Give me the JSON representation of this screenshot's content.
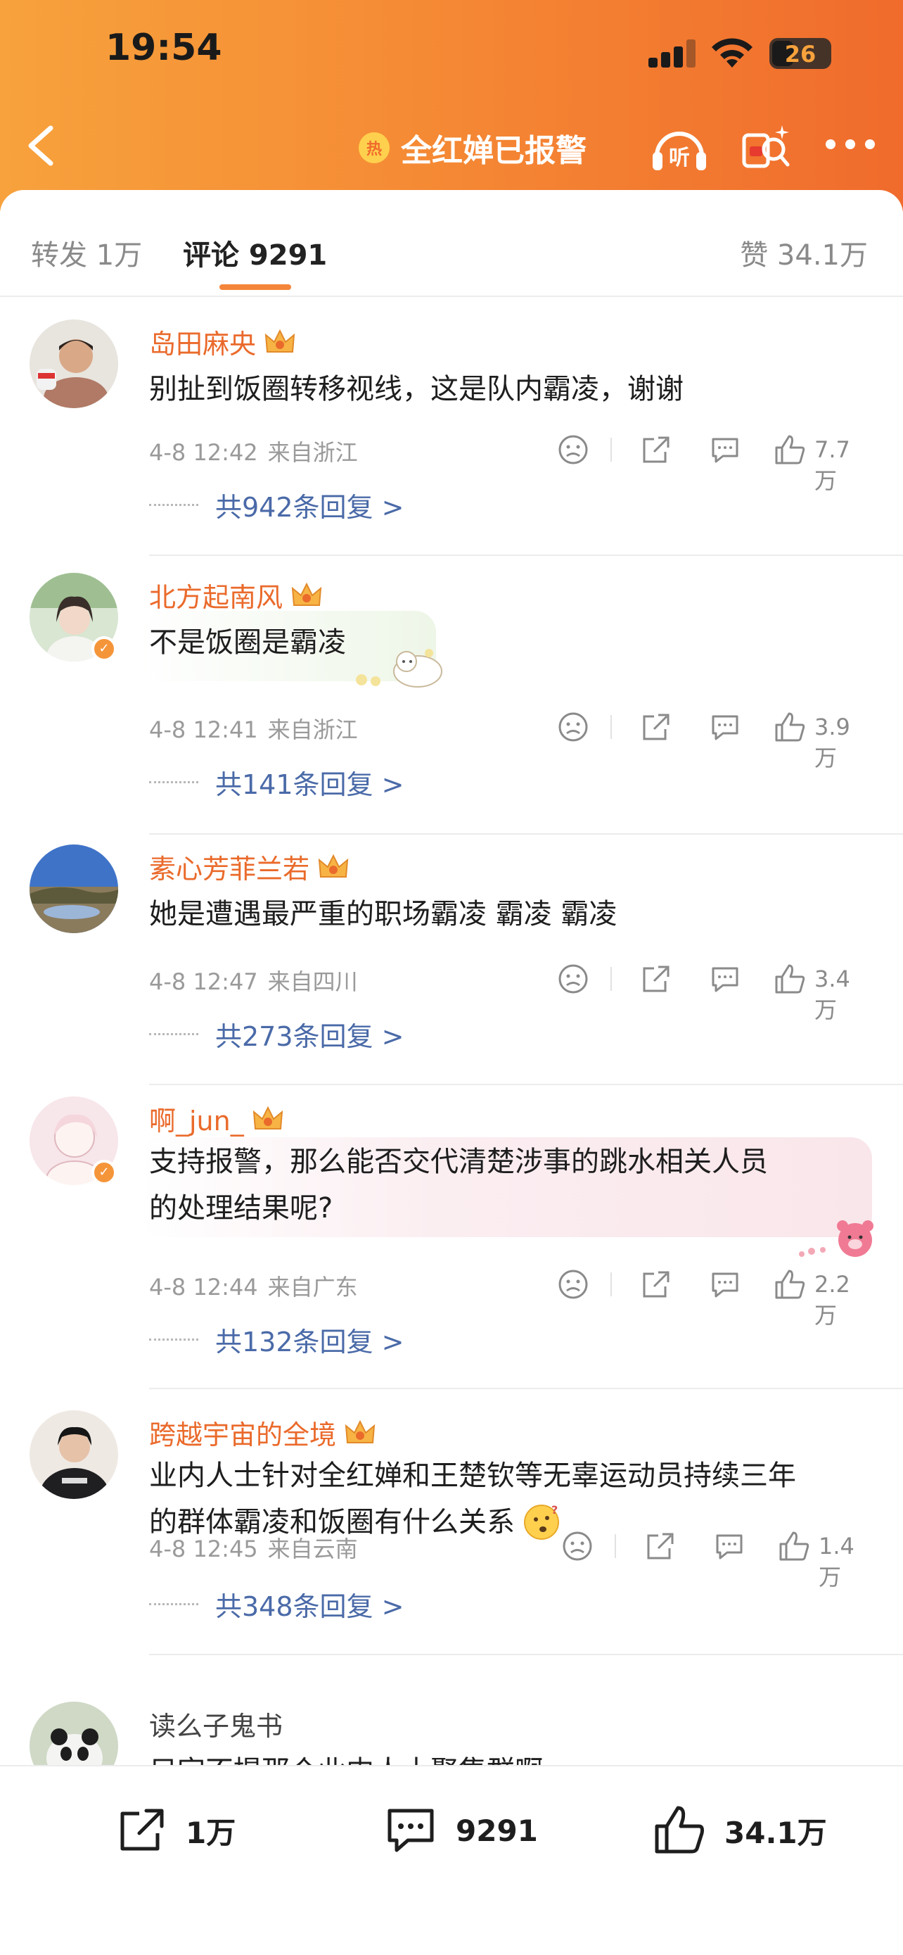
{
  "status_bar": {
    "time": "19:54",
    "battery": "26"
  },
  "nav": {
    "hot_badge": "热",
    "title": "全红婵已报警",
    "listen_label": "听"
  },
  "tabs": {
    "repost": "转发 1万",
    "comments": "评论 9291",
    "likes": "赞 34.1万"
  },
  "comments": [
    {
      "user": "岛田麻央",
      "text": "别扯到饭圈转移视线，这是队内霸凌，谢谢",
      "time": "4-8 12:42",
      "location": "来自浙江",
      "likes": "7.7万",
      "replies": "共942条回复 >"
    },
    {
      "user": "北方起南风",
      "text": "不是饭圈是霸凌",
      "time": "4-8 12:41",
      "location": "来自浙江",
      "likes": "3.9万",
      "replies": "共141条回复 >"
    },
    {
      "user": "素心芳菲兰若",
      "text": "她是遭遇最严重的职场霸凌 霸凌 霸凌",
      "time": "4-8 12:47",
      "location": "来自四川",
      "likes": "3.4万",
      "replies": "共273条回复 >"
    },
    {
      "user": "啊_jun_",
      "text_line1": "支持报警，那么能否交代清楚涉事的跳水相关人员",
      "text_line2": "的处理结果呢?",
      "time": "4-8 12:44",
      "location": "来自广东",
      "likes": "2.2万",
      "replies": "共132条回复 >"
    },
    {
      "user": "跨越宇宙的全境",
      "text_line1": "业内人士针对全红婵和王楚钦等无辜运动员持续三年",
      "text_line2": "的群体霸凌和饭圈有什么关系",
      "time": "4-8 12:45",
      "location": "来自云南",
      "likes": "1.4万",
      "replies": "共348条回复 >"
    },
    {
      "user": "读么子鬼书",
      "text": "只字不提那个业内人士聚集群啊"
    }
  ],
  "bottom_bar": {
    "repost": "1万",
    "comments": "9291",
    "likes": "34.1万"
  },
  "colors": {
    "header_gradient_start": "#f7a23c",
    "header_gradient_end": "#f06b2c",
    "username": "#ea6a2b",
    "reply_link": "#4a6aa8",
    "tab_indicator": "#f5853a"
  }
}
